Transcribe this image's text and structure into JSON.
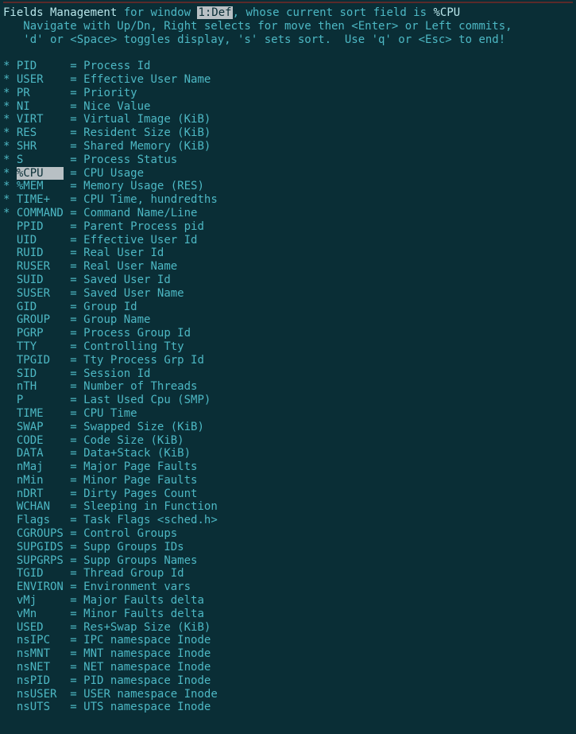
{
  "header": {
    "title_label": "Fields Management",
    "for_window_text": " for window ",
    "window_name": "1:Def",
    "sort_text": ", whose current sort field is ",
    "sort_field": "%CPU",
    "help_line1": "   Navigate with Up/Dn, Right selects for move then <Enter> or Left commits,",
    "help_line2": "   'd' or <Space> toggles display, 's' sets sort.  Use 'q' or <Esc> to end!"
  },
  "fields": [
    {
      "marker": "*",
      "name": "PID    ",
      "desc": "Process Id",
      "selected": false
    },
    {
      "marker": "*",
      "name": "USER   ",
      "desc": "Effective User Name",
      "selected": false
    },
    {
      "marker": "*",
      "name": "PR     ",
      "desc": "Priority",
      "selected": false
    },
    {
      "marker": "*",
      "name": "NI     ",
      "desc": "Nice Value",
      "selected": false
    },
    {
      "marker": "*",
      "name": "VIRT   ",
      "desc": "Virtual Image (KiB)",
      "selected": false
    },
    {
      "marker": "*",
      "name": "RES    ",
      "desc": "Resident Size (KiB)",
      "selected": false
    },
    {
      "marker": "*",
      "name": "SHR    ",
      "desc": "Shared Memory (KiB)",
      "selected": false
    },
    {
      "marker": "*",
      "name": "S      ",
      "desc": "Process Status",
      "selected": false
    },
    {
      "marker": "*",
      "name": "%CPU   ",
      "desc": "CPU Usage",
      "selected": true
    },
    {
      "marker": "*",
      "name": "%MEM   ",
      "desc": "Memory Usage (RES)",
      "selected": false
    },
    {
      "marker": "*",
      "name": "TIME+  ",
      "desc": "CPU Time, hundredths",
      "selected": false
    },
    {
      "marker": "*",
      "name": "COMMAND",
      "desc": "Command Name/Line",
      "selected": false
    },
    {
      "marker": " ",
      "name": "PPID   ",
      "desc": "Parent Process pid",
      "selected": false
    },
    {
      "marker": " ",
      "name": "UID    ",
      "desc": "Effective User Id",
      "selected": false
    },
    {
      "marker": " ",
      "name": "RUID   ",
      "desc": "Real User Id",
      "selected": false
    },
    {
      "marker": " ",
      "name": "RUSER  ",
      "desc": "Real User Name",
      "selected": false
    },
    {
      "marker": " ",
      "name": "SUID   ",
      "desc": "Saved User Id",
      "selected": false
    },
    {
      "marker": " ",
      "name": "SUSER  ",
      "desc": "Saved User Name",
      "selected": false
    },
    {
      "marker": " ",
      "name": "GID    ",
      "desc": "Group Id",
      "selected": false
    },
    {
      "marker": " ",
      "name": "GROUP  ",
      "desc": "Group Name",
      "selected": false
    },
    {
      "marker": " ",
      "name": "PGRP   ",
      "desc": "Process Group Id",
      "selected": false
    },
    {
      "marker": " ",
      "name": "TTY    ",
      "desc": "Controlling Tty",
      "selected": false
    },
    {
      "marker": " ",
      "name": "TPGID  ",
      "desc": "Tty Process Grp Id",
      "selected": false
    },
    {
      "marker": " ",
      "name": "SID    ",
      "desc": "Session Id",
      "selected": false
    },
    {
      "marker": " ",
      "name": "nTH    ",
      "desc": "Number of Threads",
      "selected": false
    },
    {
      "marker": " ",
      "name": "P      ",
      "desc": "Last Used Cpu (SMP)",
      "selected": false
    },
    {
      "marker": " ",
      "name": "TIME   ",
      "desc": "CPU Time",
      "selected": false
    },
    {
      "marker": " ",
      "name": "SWAP   ",
      "desc": "Swapped Size (KiB)",
      "selected": false
    },
    {
      "marker": " ",
      "name": "CODE   ",
      "desc": "Code Size (KiB)",
      "selected": false
    },
    {
      "marker": " ",
      "name": "DATA   ",
      "desc": "Data+Stack (KiB)",
      "selected": false
    },
    {
      "marker": " ",
      "name": "nMaj   ",
      "desc": "Major Page Faults",
      "selected": false
    },
    {
      "marker": " ",
      "name": "nMin   ",
      "desc": "Minor Page Faults",
      "selected": false
    },
    {
      "marker": " ",
      "name": "nDRT   ",
      "desc": "Dirty Pages Count",
      "selected": false
    },
    {
      "marker": " ",
      "name": "WCHAN  ",
      "desc": "Sleeping in Function",
      "selected": false
    },
    {
      "marker": " ",
      "name": "Flags  ",
      "desc": "Task Flags <sched.h>",
      "selected": false
    },
    {
      "marker": " ",
      "name": "CGROUPS",
      "desc": "Control Groups",
      "selected": false
    },
    {
      "marker": " ",
      "name": "SUPGIDS",
      "desc": "Supp Groups IDs",
      "selected": false
    },
    {
      "marker": " ",
      "name": "SUPGRPS",
      "desc": "Supp Groups Names",
      "selected": false
    },
    {
      "marker": " ",
      "name": "TGID   ",
      "desc": "Thread Group Id",
      "selected": false
    },
    {
      "marker": " ",
      "name": "ENVIRON",
      "desc": "Environment vars",
      "selected": false
    },
    {
      "marker": " ",
      "name": "vMj    ",
      "desc": "Major Faults delta",
      "selected": false
    },
    {
      "marker": " ",
      "name": "vMn    ",
      "desc": "Minor Faults delta",
      "selected": false
    },
    {
      "marker": " ",
      "name": "USED   ",
      "desc": "Res+Swap Size (KiB)",
      "selected": false
    },
    {
      "marker": " ",
      "name": "nsIPC  ",
      "desc": "IPC namespace Inode",
      "selected": false
    },
    {
      "marker": " ",
      "name": "nsMNT  ",
      "desc": "MNT namespace Inode",
      "selected": false
    },
    {
      "marker": " ",
      "name": "nsNET  ",
      "desc": "NET namespace Inode",
      "selected": false
    },
    {
      "marker": " ",
      "name": "nsPID  ",
      "desc": "PID namespace Inode",
      "selected": false
    },
    {
      "marker": " ",
      "name": "nsUSER ",
      "desc": "USER namespace Inode",
      "selected": false
    },
    {
      "marker": " ",
      "name": "nsUTS  ",
      "desc": "UTS namespace Inode",
      "selected": false
    }
  ]
}
